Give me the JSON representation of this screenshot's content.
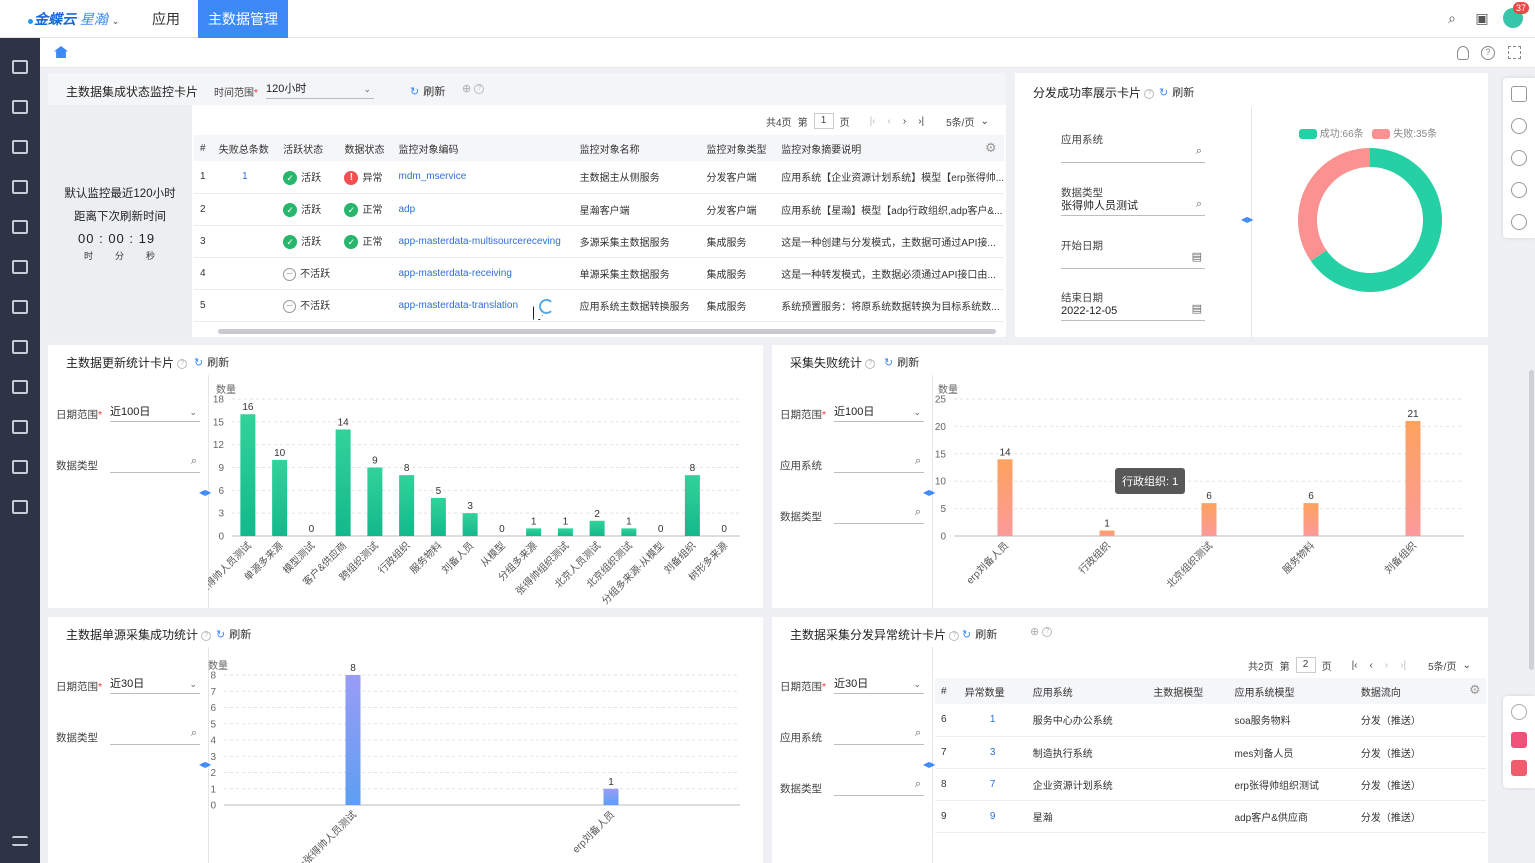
{
  "topbar": {
    "brand": "金蝶云",
    "brand_sub": "星瀚",
    "nav_app": "应用",
    "nav_active": "主数据管理",
    "badge": "37"
  },
  "card1": {
    "title": "主数据集成状态监控卡片",
    "time_label": "时间范围",
    "time_value": "120小时",
    "refresh": "刷新",
    "left_line1": "默认监控最近120小时",
    "left_line2": "距离下次刷新时间",
    "countdown": {
      "h": "00",
      "m": "00",
      "s": "19",
      "h_unit": "时",
      "m_unit": "分",
      "s_unit": "秒"
    },
    "pager": {
      "total": "共4页",
      "page_prefix": "第",
      "page": "1",
      "page_suffix": "页",
      "size": "5条/页"
    },
    "columns": [
      "#",
      "失败总条数",
      "活跃状态",
      "数据状态",
      "监控对象编码",
      "监控对象名称",
      "监控对象类型",
      "监控对象摘要说明"
    ],
    "rows": [
      {
        "n": "1",
        "fail": "1",
        "active": "活跃",
        "active_state": "ok",
        "data": "异常",
        "data_state": "err",
        "code": "mdm_mservice",
        "name": "主数据主从侧服务",
        "type": "分发客户端",
        "desc": "应用系统【企业资源计划系统】模型【erp张得帅..."
      },
      {
        "n": "2",
        "fail": "",
        "active": "活跃",
        "active_state": "ok",
        "data": "正常",
        "data_state": "ok",
        "code": "adp",
        "name": "星瀚客户端",
        "type": "分发客户端",
        "desc": "应用系统【星瀚】模型【adp行政组织,adp客户&..."
      },
      {
        "n": "3",
        "fail": "",
        "active": "活跃",
        "active_state": "ok",
        "data": "正常",
        "data_state": "ok",
        "code": "app-masterdata-multisourcereceving",
        "name": "多源采集主数据服务",
        "type": "集成服务",
        "desc": "这是一种创建与分发模式，主数据可通过API接..."
      },
      {
        "n": "4",
        "fail": "",
        "active": "不活跃",
        "active_state": "off",
        "data": "",
        "data_state": "",
        "code": "app-masterdata-receiving",
        "name": "单源采集主数据服务",
        "type": "集成服务",
        "desc": "这是一种转发模式，主数据必须通过API接口由..."
      },
      {
        "n": "5",
        "fail": "",
        "active": "不活跃",
        "active_state": "off",
        "data": "",
        "data_state": "",
        "code": "app-masterdata-translation",
        "name": "应用系统主数据转换服务",
        "type": "集成服务",
        "desc": "系统预置服务：将原系统数据转换为目标系统数..."
      }
    ]
  },
  "card2": {
    "title": "分发成功率展示卡片",
    "refresh": "刷新",
    "f_app": "应用系统",
    "f_app_value": "",
    "f_type": "数据类型",
    "f_type_value": "张得帅人员测试",
    "f_start": "开始日期",
    "f_start_value": "",
    "f_end": "结束日期",
    "f_end_value": "2022-12-05",
    "legend_success": "成功:66条",
    "legend_fail": "失败:35条",
    "success": 66,
    "fail": 35,
    "color_success": "#25d0a5",
    "color_fail": "#fb9191"
  },
  "card3": {
    "title": "主数据更新统计卡片",
    "refresh": "刷新",
    "date_label": "日期范围",
    "date_value": "近100日",
    "type_label": "数据类型",
    "type_value": "",
    "chart_data": {
      "type": "bar",
      "ylabel": "数量",
      "ylim": [
        0,
        18
      ],
      "yticks": [
        0,
        3,
        6,
        9,
        12,
        15,
        18
      ],
      "categories": [
        "张得帅人员测试",
        "单源多来源",
        "模型测试",
        "客户&供应商",
        "跨组织测试",
        "行政组织",
        "服务物料",
        "刘备人员",
        "从模型",
        "分组多来源",
        "张得帅组织测试",
        "北京人员测试",
        "北京组织测试",
        "分组多来源-从模型",
        "刘备组织",
        "树形多来源"
      ],
      "values": [
        16,
        10,
        0,
        14,
        9,
        8,
        5,
        3,
        0,
        1,
        1,
        2,
        1,
        0,
        8,
        0
      ],
      "color_top": "#32d29a",
      "color_bottom": "#14b88a"
    }
  },
  "card4": {
    "title": "采集失败统计",
    "refresh": "刷新",
    "date_label": "日期范围",
    "date_value": "近100日",
    "app_label": "应用系统",
    "app_value": "",
    "type_label": "数据类型",
    "type_value": "",
    "tooltip": "行政组织: 1",
    "chart_data": {
      "type": "bar",
      "ylabel": "数量",
      "ylim": [
        0,
        25
      ],
      "yticks": [
        0,
        5,
        10,
        15,
        20,
        25
      ],
      "categories": [
        "erp刘备人员",
        "行政组织",
        "北京组织测试",
        "服务物料",
        "刘备组织"
      ],
      "values": [
        14,
        1,
        6,
        6,
        21
      ],
      "color_top": "#fda25d",
      "color_bottom": "#fb9a9a"
    }
  },
  "card5": {
    "title": "主数据单源采集成功统计",
    "refresh": "刷新",
    "date_label": "日期范围",
    "date_value": "近30日",
    "type_label": "数据类型",
    "type_value": "",
    "chart_data": {
      "type": "bar",
      "ylabel": "数量",
      "ylim": [
        0,
        8
      ],
      "yticks": [
        0,
        1,
        2,
        3,
        4,
        5,
        6,
        7,
        8
      ],
      "categories": [
        "mes张得帅人员测试",
        "erp刘备人员"
      ],
      "values": [
        8,
        1
      ],
      "color_top": "#9a9cf6",
      "color_bottom": "#5c9ff2"
    }
  },
  "card6": {
    "title": "主数据采集分发异常统计卡片",
    "refresh": "刷新",
    "date_label": "日期范围",
    "date_value": "近30日",
    "app_label": "应用系统",
    "app_value": "",
    "type_label": "数据类型",
    "type_value": "",
    "pager": {
      "total": "共2页",
      "page_prefix": "第",
      "page": "2",
      "page_suffix": "页",
      "size": "5条/页"
    },
    "columns": [
      "#",
      "异常数量",
      "应用系统",
      "主数据模型",
      "应用系统模型",
      "数据流向"
    ],
    "rows": [
      {
        "n": "6",
        "count": "1",
        "app": "服务中心办公系统",
        "model": "",
        "app_model": "soa服务物料",
        "flow": "分发（推送）"
      },
      {
        "n": "7",
        "count": "3",
        "app": "制造执行系统",
        "model": "",
        "app_model": "mes刘备人员",
        "flow": "分发（推送）"
      },
      {
        "n": "8",
        "count": "7",
        "app": "企业资源计划系统",
        "model": "",
        "app_model": "erp张得帅组织测试",
        "flow": "分发（推送）"
      },
      {
        "n": "9",
        "count": "9",
        "app": "星瀚",
        "model": "",
        "app_model": "adp客户&供应商",
        "flow": "分发（推送）"
      }
    ]
  }
}
